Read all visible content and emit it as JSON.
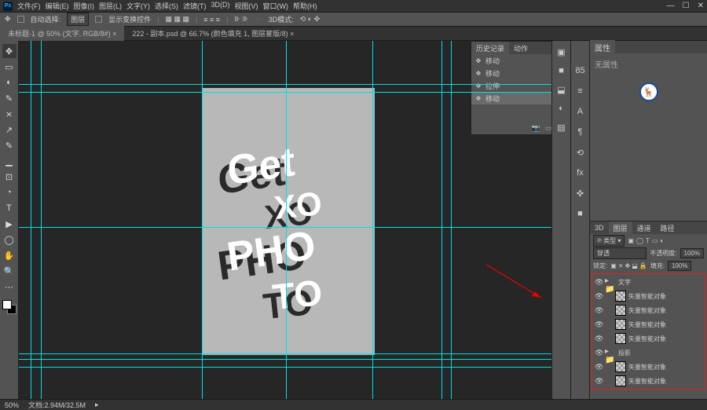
{
  "menu": [
    "文件(F)",
    "编辑(E)",
    "图像(I)",
    "图层(L)",
    "文字(Y)",
    "选择(S)",
    "滤镜(T)",
    "3D(D)",
    "视图(V)",
    "窗口(W)",
    "帮助(H)"
  ],
  "window_controls": [
    "—",
    "☐",
    "✕"
  ],
  "options": {
    "tool_icon": "✥",
    "auto_select": "自动选择:",
    "mode": "图层",
    "show_transform": "显示变换控件",
    "mode3d": "3D模式:"
  },
  "tabs": [
    {
      "label": "未标题-1 @ 50% (文字, RGB/8#)",
      "active": true
    },
    {
      "label": "222 - 副本.psd @ 66.7% (颜色填充 1, 图层蒙版/8)",
      "active": false
    }
  ],
  "tools": [
    "✥",
    "▭",
    "◐",
    "✎",
    "⨯",
    "↗",
    "✎",
    "▁",
    "⊡",
    "◔",
    "T",
    "▶",
    "◯",
    "✋",
    "🔍",
    "⋯"
  ],
  "canvas": {
    "guides_h": [
      55,
      65,
      237,
      398,
      405,
      415
    ],
    "guides_v": [
      15,
      28,
      233,
      340,
      450,
      538,
      550
    ]
  },
  "artwork": {
    "words": [
      "Get",
      "XO",
      "PHO",
      "TO"
    ]
  },
  "history": {
    "title": "历史记录",
    "other": "动作",
    "items": [
      {
        "label": "移动"
      },
      {
        "label": "移动"
      },
      {
        "label": "拉伸"
      },
      {
        "label": "移动",
        "hl": true
      }
    ]
  },
  "right_strip1": [
    "▣",
    "■",
    "⬓",
    "◐",
    "▤"
  ],
  "right_strip2": [
    "85",
    "≡",
    "A",
    "¶",
    "⟲",
    "fx",
    "✜",
    "■"
  ],
  "properties": {
    "tab": "属性",
    "content": "无属性"
  },
  "layers": {
    "tabs": [
      "3D",
      "图层",
      "通道",
      "路径"
    ],
    "active_tab": 1,
    "type": "类型",
    "filter_icons": [
      "▣",
      "◯",
      "T",
      "▭",
      "◐"
    ],
    "blend": "穿透",
    "opacity_label": "不透明度:",
    "opacity": "100%",
    "lock_label": "锁定:",
    "lock_icons": [
      "▣",
      "⨯",
      "✥",
      "⬓",
      "🔒"
    ],
    "fill_label": "填充:",
    "fill": "100%",
    "items": [
      {
        "type": "folder",
        "name": "文字",
        "indent": 0
      },
      {
        "type": "smart",
        "name": "矢量智能对象",
        "indent": 1
      },
      {
        "type": "smart",
        "name": "矢量智能对象",
        "indent": 1
      },
      {
        "type": "smart",
        "name": "矢量智能对象",
        "indent": 1
      },
      {
        "type": "smart",
        "name": "矢量智能对象",
        "indent": 1
      },
      {
        "type": "folder",
        "name": "投影",
        "indent": 0
      },
      {
        "type": "smart",
        "name": "矢量智能对象",
        "indent": 1
      },
      {
        "type": "smart",
        "name": "矢量智能对象",
        "indent": 1
      }
    ]
  },
  "status": {
    "zoom": "50%",
    "doc": "文档:2.94M/32.5M"
  }
}
